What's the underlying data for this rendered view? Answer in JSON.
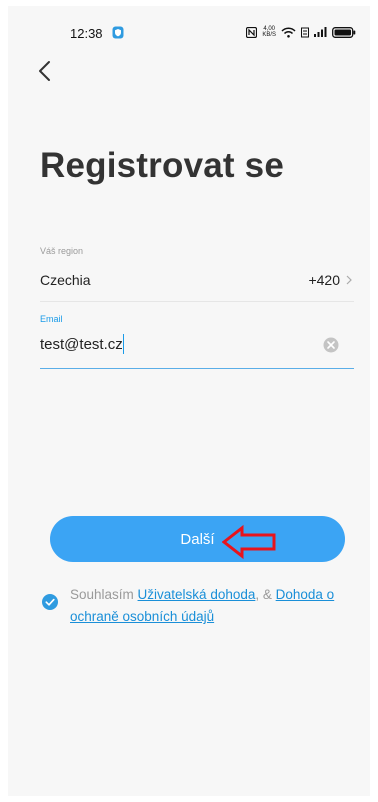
{
  "status_bar": {
    "time": "12:38",
    "speed_top": "4,00",
    "speed_bottom": "KB/S"
  },
  "page": {
    "title": "Registrovat se"
  },
  "form": {
    "region_label": "Váš region",
    "region_value": "Czechia",
    "region_code": "+420",
    "email_label": "Email",
    "email_value": "test@test.cz"
  },
  "actions": {
    "next_label": "Další"
  },
  "agreement": {
    "checked": true,
    "prefix": "Souhlasím ",
    "link1": "Uživatelská dohoda",
    "separator": ", & ",
    "link2": "Dohoda o ochraně osobních údajů"
  },
  "colors": {
    "accent": "#3ba4f4",
    "link": "#1a8fd8",
    "annotation": "#e8141c"
  },
  "icons": [
    "back-icon",
    "chevron-right-icon",
    "clear-icon",
    "check-icon",
    "wifi-icon",
    "battery-icon",
    "nfc-icon",
    "signal-icon",
    "shield-icon"
  ]
}
